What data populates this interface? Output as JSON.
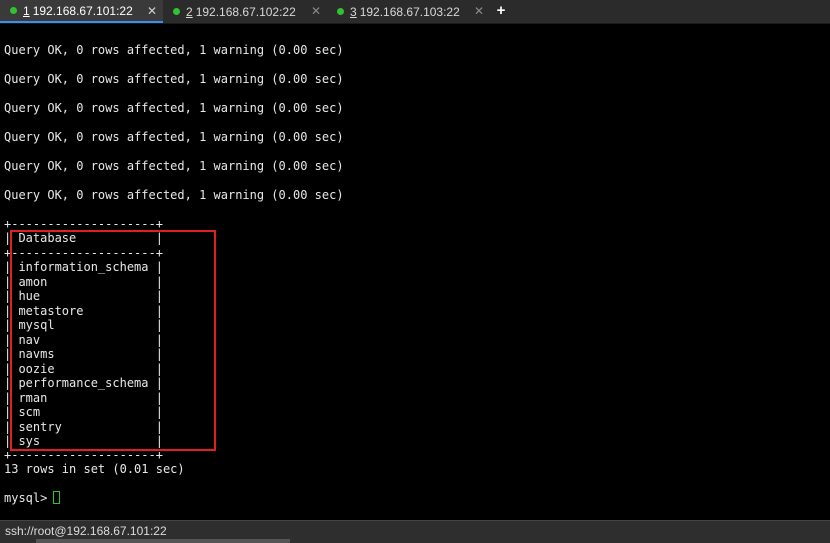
{
  "tabs": [
    {
      "number": "1",
      "title": "192.168.67.101:22",
      "close": "✕",
      "active": true
    },
    {
      "number": "2",
      "title": "192.168.67.102:22",
      "close": "✕",
      "active": false
    },
    {
      "number": "3",
      "title": "192.168.67.103:22",
      "close": "✕",
      "active": false
    }
  ],
  "new_tab_label": "+",
  "terminal": {
    "query_lines": [
      "Query OK, 0 rows affected, 1 warning (0.00 sec)",
      "Query OK, 0 rows affected, 1 warning (0.00 sec)",
      "Query OK, 0 rows affected, 1 warning (0.00 sec)",
      "Query OK, 0 rows affected, 1 warning (0.00 sec)",
      "Query OK, 0 rows affected, 1 warning (0.00 sec)",
      "Query OK, 0 rows affected, 1 warning (0.00 sec)"
    ],
    "table_border": "+--------------------+",
    "table_header": "| Database           |",
    "table_rows": [
      "| information_schema |",
      "| amon               |",
      "| hue                |",
      "| metastore          |",
      "| mysql              |",
      "| nav                |",
      "| navms              |",
      "| oozie              |",
      "| performance_schema |",
      "| rman               |",
      "| scm                |",
      "| sentry             |",
      "| sys                |"
    ],
    "result_summary": "13 rows in set (0.01 sec)",
    "prompt": "mysql> "
  },
  "status_bar": {
    "text": "ssh://root@192.168.67.101:22"
  },
  "colors": {
    "highlight": "#e02020",
    "tab_dot": "#2fc42f",
    "active_tab_underline": "#3b8ef0"
  }
}
